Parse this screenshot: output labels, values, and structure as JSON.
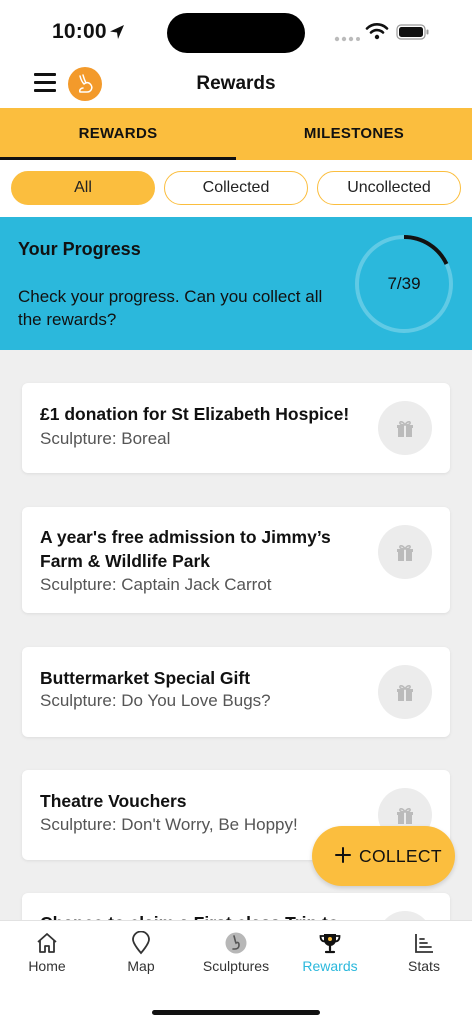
{
  "status": {
    "time": "10:00"
  },
  "header": {
    "title": "Rewards"
  },
  "tabs": [
    {
      "label": "REWARDS",
      "active": true
    },
    {
      "label": "MILESTONES",
      "active": false
    }
  ],
  "filters": [
    {
      "label": "All",
      "active": true
    },
    {
      "label": "Collected",
      "active": false
    },
    {
      "label": "Uncollected",
      "active": false
    }
  ],
  "progress": {
    "title": "Your Progress",
    "text": "Check your progress. Can you collect all the rewards?",
    "count": "7/39",
    "collected": 7,
    "total": 39
  },
  "rewards": [
    {
      "title": "£1 donation for St Elizabeth Hospice!",
      "sculpture": "Sculpture: Boreal"
    },
    {
      "title": "A year's free admission to Jimmy’s Farm & Wildlife Park",
      "sculpture": "Sculpture: Captain Jack Carrot"
    },
    {
      "title": "Buttermarket Special Gift",
      "sculpture": "Sculpture: Do You Love Bugs?"
    },
    {
      "title": "Theatre Vouchers",
      "sculpture": "Sculpture: Don't Worry, Be Hoppy!"
    },
    {
      "title": "Chance to claim a First class Trip to",
      "sculpture": ""
    }
  ],
  "fab": {
    "label": "COLLECT"
  },
  "nav": [
    {
      "label": "Home",
      "icon": "home-icon"
    },
    {
      "label": "Map",
      "icon": "map-pin-icon"
    },
    {
      "label": "Sculptures",
      "icon": "sculpture-icon"
    },
    {
      "label": "Rewards",
      "icon": "trophy-icon",
      "active": true
    },
    {
      "label": "Stats",
      "icon": "stats-icon"
    }
  ],
  "colors": {
    "accent": "#fbbe3e",
    "progress_bg": "#2bb8dc",
    "logo": "#f39a2b"
  }
}
